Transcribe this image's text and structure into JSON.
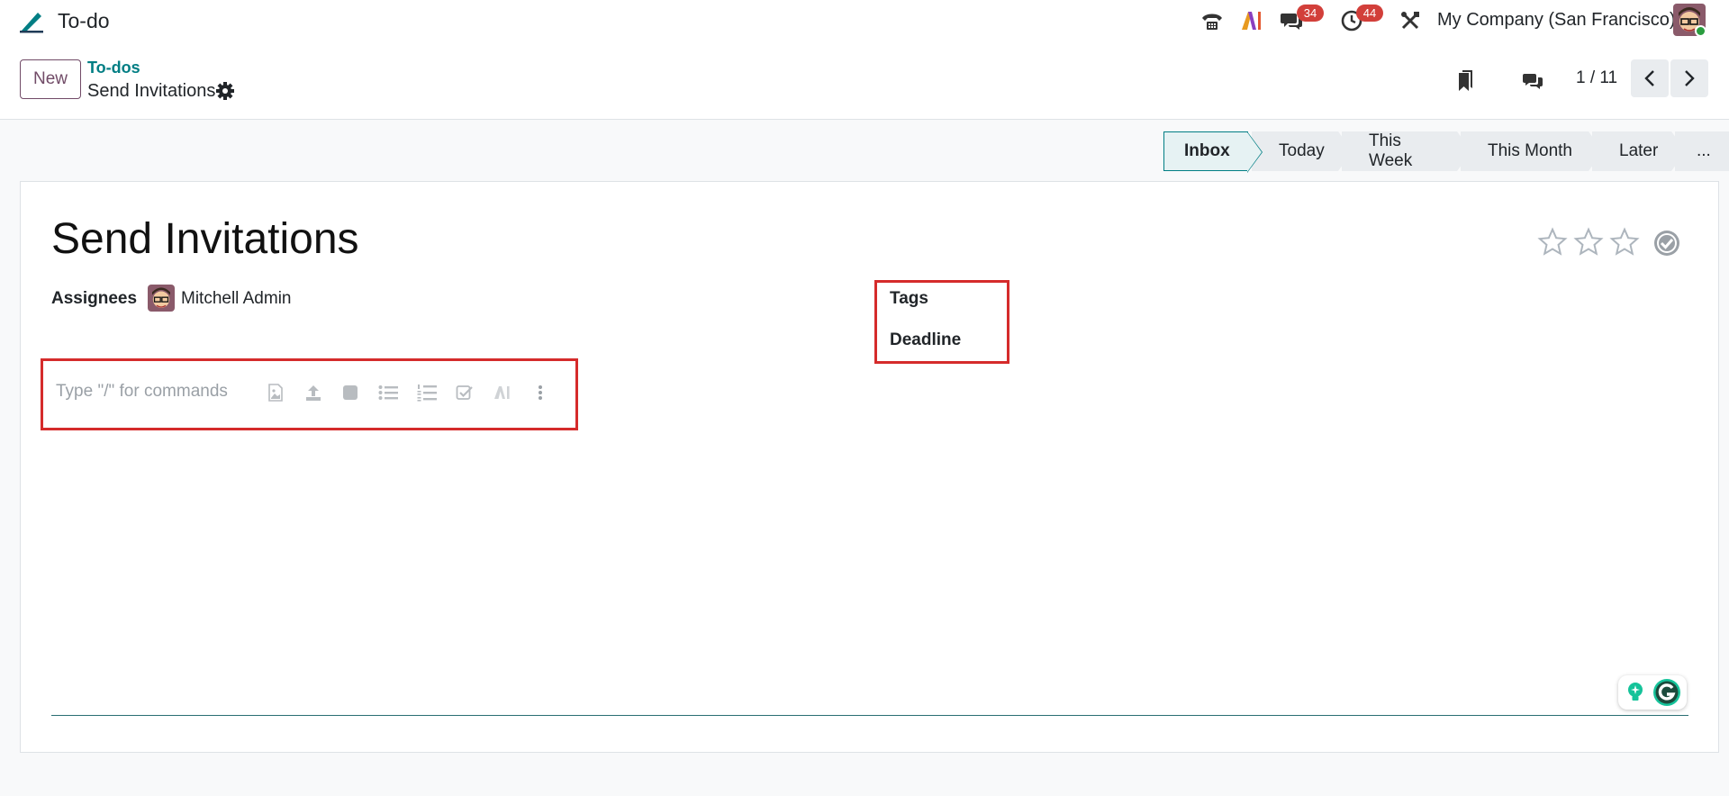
{
  "app": {
    "title": "To-do"
  },
  "navbar": {
    "messages_count": "34",
    "activities_count": "44",
    "company": "My Company (San Francisco)"
  },
  "control": {
    "new_label": "New",
    "breadcrumb_parent": "To-dos",
    "breadcrumb_current": "Send Invitations",
    "pager": "1 / 11"
  },
  "stages": [
    "Inbox",
    "Today",
    "This Week",
    "This Month",
    "Later",
    "..."
  ],
  "record": {
    "title": "Send Invitations",
    "assignees_label": "Assignees",
    "assignee_name": "Mitchell Admin",
    "tags_label": "Tags",
    "deadline_label": "Deadline",
    "editor_placeholder": "Type \"/\" for commands"
  },
  "colors": {
    "brand": "#714b67",
    "accent": "#017e84",
    "badge": "#d23f3a",
    "highlight": "#d52b2b"
  }
}
